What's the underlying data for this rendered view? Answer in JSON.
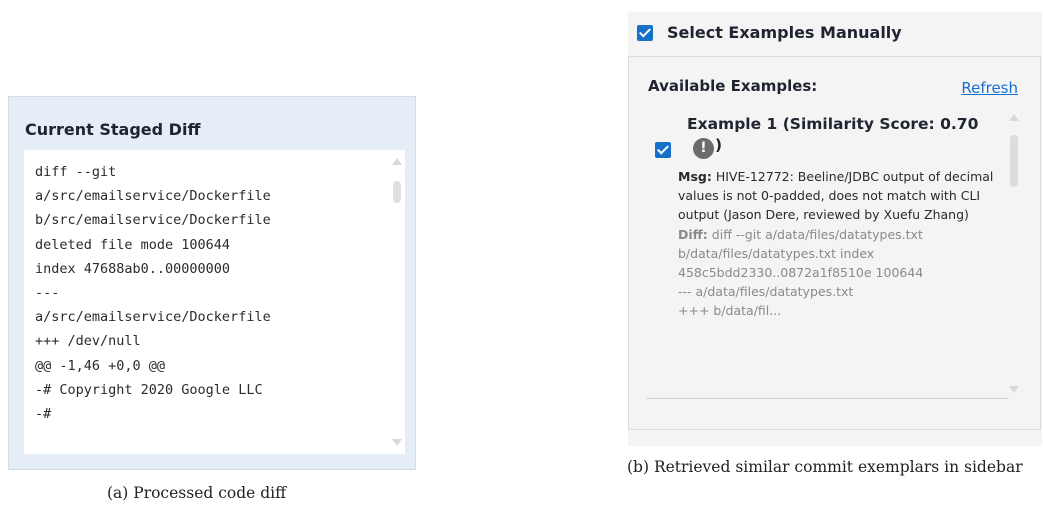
{
  "diff_panel": {
    "title": "Current Staged Diff",
    "lines": [
      "diff --git",
      "a/src/emailservice/Dockerfile",
      "b/src/emailservice/Dockerfile",
      "deleted file mode 100644",
      "index 47688ab0..00000000",
      "---",
      "a/src/emailservice/Dockerfile",
      "+++ /dev/null",
      "@@ -1,46 +0,0 @@",
      "-# Copyright 2020 Google LLC",
      "-#"
    ],
    "caption": "(a) Processed code diff"
  },
  "sidebar": {
    "select_manual_label": "Select Examples Manually",
    "select_manual_checked": true,
    "available_label": "Available Examples:",
    "refresh_label": "Refresh",
    "example": {
      "title": "Example 1 (Similarity Score: 0.70",
      "title_close": ")",
      "info_icon": "exclamation-icon",
      "info_glyph": "!",
      "checked": true,
      "msg_label": "Msg:",
      "msg_text": "HIVE-12772: Beeline/JDBC output of decimal values is not 0-padded, does not match with CLI output (Jason Dere, reviewed by Xuefu Zhang)",
      "diff_label": "Diff:",
      "diff_text": "diff --git a/data/files/datatypes.txt b/data/files/datatypes.txt index 458c5bdd2330..0872a1f8510e 100644",
      "diff_line_2": "--- a/data/files/datatypes.txt",
      "diff_line_3": "+++ b/data/fil..."
    },
    "caption": "(b) Retrieved similar commit exemplars in sidebar"
  },
  "colors": {
    "accent": "#1570c8",
    "link": "#1a6fd1",
    "panel_bg": "#e5edf7",
    "sidebar_bg": "#f4f4f4"
  }
}
